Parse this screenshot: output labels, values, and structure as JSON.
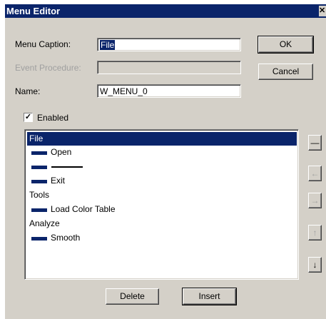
{
  "window": {
    "title": "Menu Editor",
    "close_glyph": "✕"
  },
  "form": {
    "caption_label": "Menu Caption:",
    "caption_value": "File",
    "event_label": "Event Procedure:",
    "event_value": "",
    "name_label": "Name:",
    "name_value": "W_MENU_0",
    "enabled_label": "Enabled",
    "enabled_checked": true
  },
  "buttons": {
    "ok": "OK",
    "cancel": "Cancel",
    "delete": "Delete",
    "insert": "Insert"
  },
  "menu_items": [
    {
      "label": "File",
      "level": 0,
      "selected": true
    },
    {
      "label": "Open",
      "level": 1,
      "selected": false
    },
    {
      "label": "",
      "level": 1,
      "separator": true,
      "selected": false
    },
    {
      "label": "Exit",
      "level": 1,
      "selected": false
    },
    {
      "label": "Tools",
      "level": 0,
      "selected": false
    },
    {
      "label": "Load Color Table",
      "level": 1,
      "selected": false
    },
    {
      "label": "Analyze",
      "level": 0,
      "selected": false
    },
    {
      "label": "Smooth",
      "level": 1,
      "selected": false
    }
  ],
  "side_buttons": [
    {
      "name": "separator-button",
      "icon": "separator-icon",
      "glyph": "—",
      "enabled": true
    },
    {
      "name": "move-left-button",
      "icon": "arrow-left-icon",
      "glyph": "←",
      "enabled": false
    },
    {
      "name": "move-right-button",
      "icon": "arrow-right-icon",
      "glyph": "→",
      "enabled": false
    },
    {
      "name": "move-up-button",
      "icon": "arrow-up-icon",
      "glyph": "↑",
      "enabled": false
    },
    {
      "name": "move-down-button",
      "icon": "arrow-down-icon",
      "glyph": "↓",
      "enabled": true
    }
  ],
  "colors": {
    "title_bar": "#0a246a",
    "face": "#d4d0c8",
    "selection": "#0a246a"
  }
}
